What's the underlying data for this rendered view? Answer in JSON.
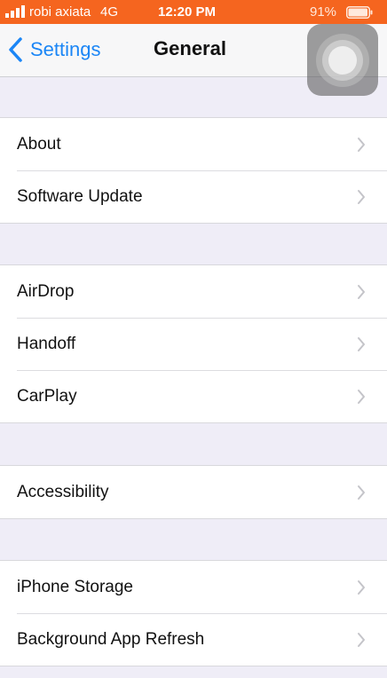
{
  "status_bar": {
    "carrier": "robi axiata",
    "network": "4G",
    "time": "12:20 PM",
    "battery": "91%",
    "background_color": "#f5651f"
  },
  "nav": {
    "back_label": "Settings",
    "title": "General",
    "accent_color": "#1b86f6"
  },
  "groups": [
    {
      "items": [
        {
          "label": "About"
        },
        {
          "label": "Software Update"
        }
      ]
    },
    {
      "items": [
        {
          "label": "AirDrop"
        },
        {
          "label": "Handoff"
        },
        {
          "label": "CarPlay"
        }
      ]
    },
    {
      "items": [
        {
          "label": "Accessibility"
        }
      ]
    },
    {
      "items": [
        {
          "label": "iPhone Storage"
        },
        {
          "label": "Background App Refresh"
        }
      ]
    }
  ]
}
